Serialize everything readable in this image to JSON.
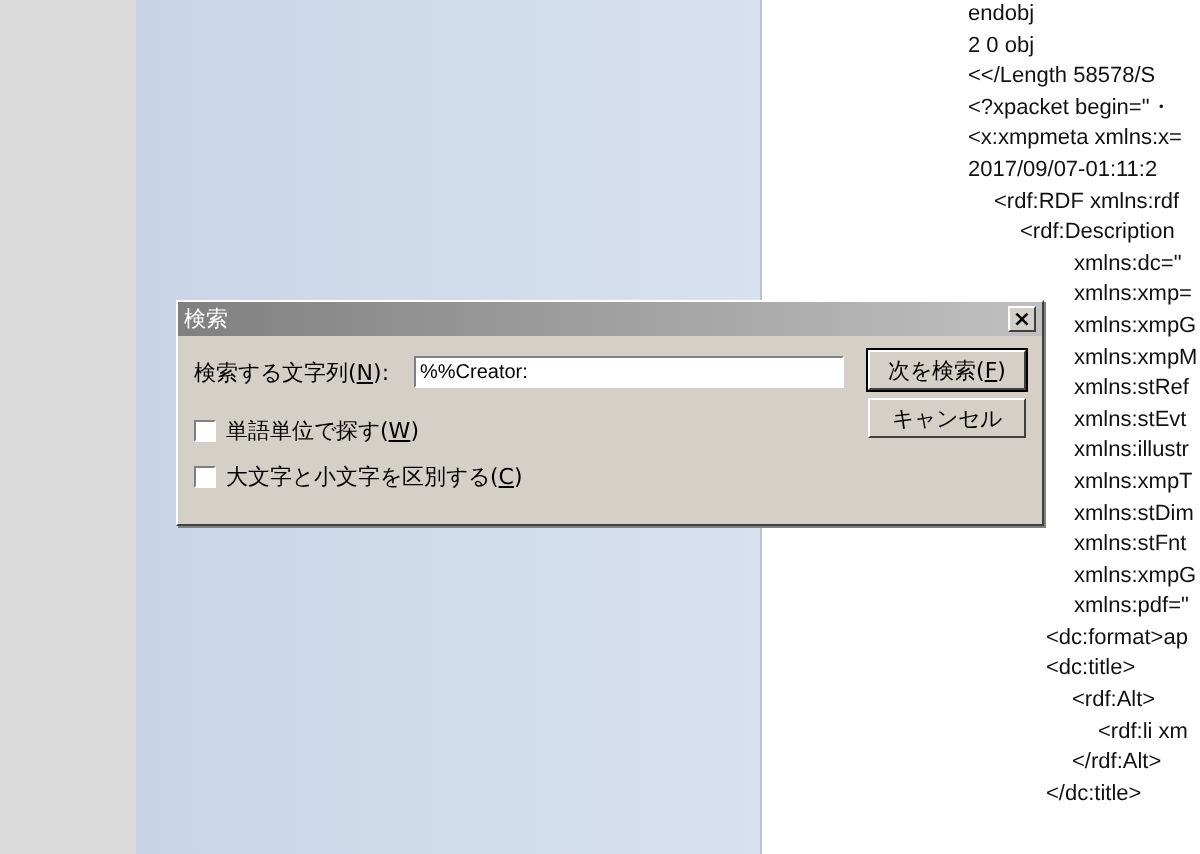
{
  "document_lines": [
    {
      "text": "endobj",
      "kind": "element"
    },
    {
      "text": "2 0 obj",
      "kind": "element"
    },
    {
      "text": "<</Length 58578/S",
      "kind": "element"
    },
    {
      "text": "<?xpacket begin=\"・",
      "kind": "element"
    },
    {
      "text": "<x:xmpmeta xmlns:x=",
      "kind": "element"
    },
    {
      "text": "2017/09/07-01:11:2",
      "kind": "element",
      "children": [
        {
          "text": "<rdf:RDF xmlns:rdf",
          "kind": "element",
          "children": [
            {
              "text": "<rdf:Description",
              "kind": "element",
              "children": [
                {
                  "text": "xmlns:dc=\"",
                  "kind": "attribute"
                },
                {
                  "text": "xmlns:xmp=",
                  "kind": "attribute"
                },
                {
                  "text": "xmlns:xmpG",
                  "kind": "attribute"
                },
                {
                  "text": "xmlns:xmpM",
                  "kind": "attribute"
                },
                {
                  "text": "xmlns:stRef",
                  "kind": "attribute"
                },
                {
                  "text": "xmlns:stEvt",
                  "kind": "attribute"
                },
                {
                  "text": "xmlns:illustr",
                  "kind": "attribute"
                },
                {
                  "text": "xmlns:xmpT",
                  "kind": "attribute"
                },
                {
                  "text": "xmlns:stDim",
                  "kind": "attribute"
                },
                {
                  "text": "xmlns:stFnt",
                  "kind": "attribute"
                },
                {
                  "text": "xmlns:xmpG",
                  "kind": "attribute"
                },
                {
                  "text": "xmlns:pdf=\"",
                  "kind": "attribute"
                },
                {
                  "text": "<dc:format>ap",
                  "kind": "element"
                },
                {
                  "text": "<dc:title>",
                  "kind": "element",
                  "children": [
                    {
                      "text": "<rdf:Alt>",
                      "kind": "element",
                      "children": [
                        {
                          "text": "<rdf:li xm",
                          "kind": "element"
                        }
                      ]
                    },
                    {
                      "text": "</rdf:Alt>",
                      "kind": "element"
                    }
                  ]
                },
                {
                  "text": "</dc:title>",
                  "kind": "element"
                }
              ]
            }
          ]
        }
      ]
    }
  ],
  "find_dialog": {
    "title": "検索",
    "close": "×",
    "search_label": {
      "text": "検索する文字列(",
      "mnemonic": "N",
      "after": "):"
    },
    "search_value": "%%Creator:",
    "options": [
      {
        "text": "単語単位で探す(",
        "mnemonic": "W",
        "after": ")",
        "checked": false
      },
      {
        "text": "大文字と小文字を区別する(",
        "mnemonic": "C",
        "after": ")",
        "checked": false
      }
    ],
    "buttons": [
      {
        "text": "次を検索(",
        "mnemonic": "F",
        "after": ")",
        "kind": "default"
      },
      {
        "text": "キャンセル",
        "kind": "normal"
      }
    ]
  }
}
